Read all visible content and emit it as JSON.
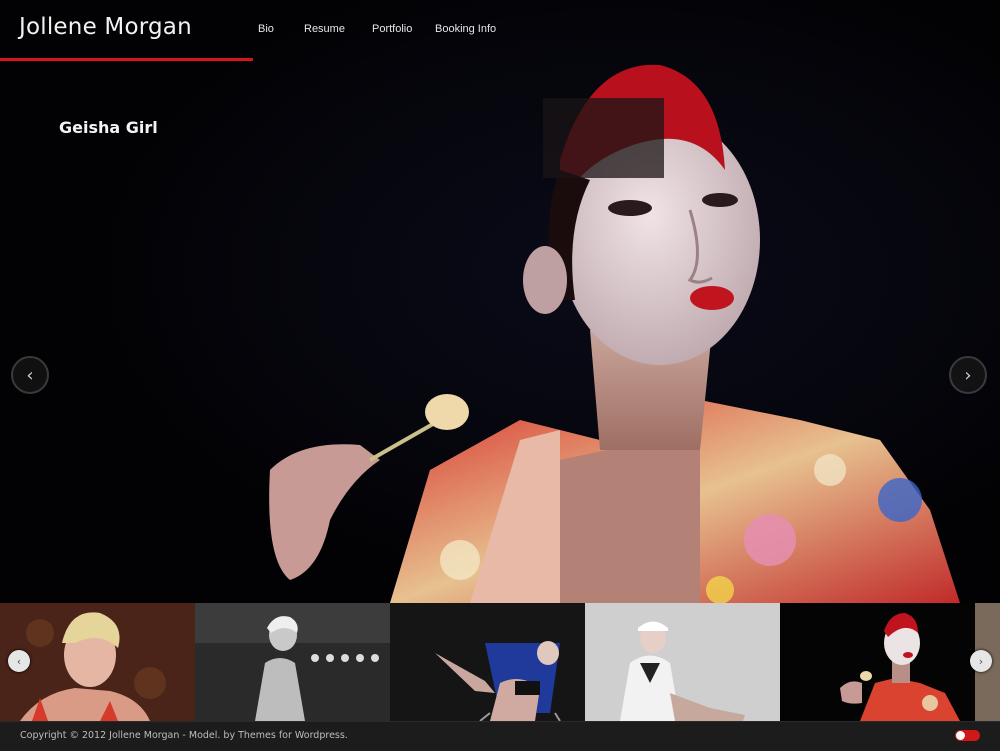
{
  "site": {
    "title": "Jollene Morgan"
  },
  "nav": {
    "items": [
      "Bio",
      "Resume",
      "Portfolio",
      "Booking Info"
    ]
  },
  "slider": {
    "caption": "Geisha Girl",
    "prev_icon": "chevron-left-icon",
    "next_icon": "chevron-right-icon",
    "prev_glyph": "‹",
    "next_glyph": "›"
  },
  "thumbnails": {
    "prev_glyph": "‹",
    "next_glyph": "›",
    "items": [
      {
        "name": "portrait-blonde-red-top"
      },
      {
        "name": "portrait-black-white-stage"
      },
      {
        "name": "portrait-butterfly-chair"
      },
      {
        "name": "portrait-sailor-outfit"
      },
      {
        "name": "portrait-geisha-girl"
      }
    ]
  },
  "footer": {
    "copyright": "Copyright © 2012 Jollene Morgan - Model. by Themes for Wordpress."
  },
  "colors": {
    "accent": "#d4161b",
    "background": "#000000",
    "footer": "#1c1c1c"
  }
}
